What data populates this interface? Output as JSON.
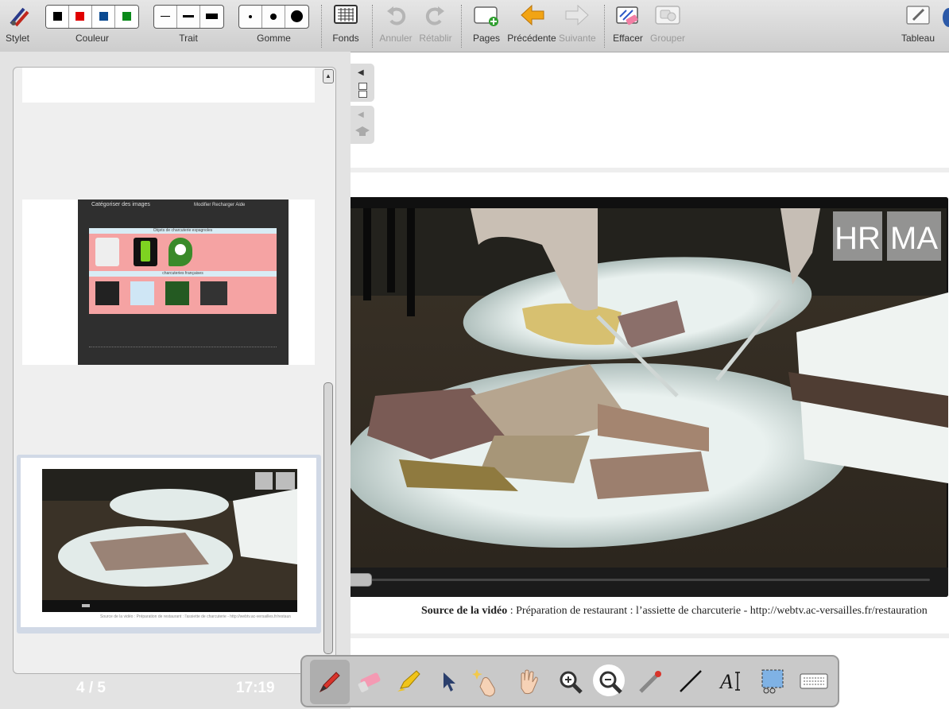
{
  "toolbar": {
    "stylet": "Stylet",
    "couleur": "Couleur",
    "trait": "Trait",
    "gomme": "Gomme",
    "fonds": "Fonds",
    "annuler": "Annuler",
    "retablir": "Rétablir",
    "pages": "Pages",
    "precedente": "Précédente",
    "suivante": "Suivante",
    "effacer": "Effacer",
    "grouper": "Grouper",
    "tableau": "Tableau",
    "colors": [
      "#000000",
      "#e00000",
      "#0b4a91",
      "#0a8a1a"
    ]
  },
  "left_panel": {
    "page_indicator": "4 / 5",
    "clock": "17:19",
    "slide3": {
      "title": "Catégoriser des images",
      "links": "Modifier  Recharger  Aide",
      "row1_label": "Objets de charcuterie espagnoles",
      "row2_label": "charcuteries françaises"
    },
    "slide4": {
      "watermark": "HRMA",
      "caption": "Source de la vidéo : Préparation de restaurant : l'assiette de charcuterie - http://webtv.ac-versailles.fr/restauration"
    }
  },
  "main": {
    "video_watermark_left": "HR",
    "video_watermark_right": "MA",
    "video_progress": 0.0,
    "caption_source": "Source de la vidéo",
    "caption_text": " : Préparation de restaurant : l’assiette de charcuterie - http://webtv.ac-versailles.fr/restauration"
  },
  "bottom_tools": [
    "pen-icon",
    "eraser-icon",
    "highlighter-icon",
    "pointer-icon",
    "magic-touch-icon",
    "hand-icon",
    "zoom-in-icon",
    "zoom-out-icon",
    "laser-pointer-icon",
    "line-icon",
    "text-icon",
    "screen-capture-icon",
    "keyboard-icon"
  ]
}
